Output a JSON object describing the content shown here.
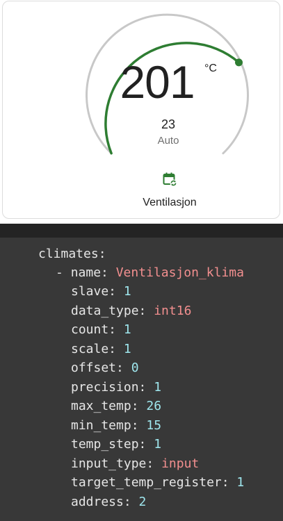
{
  "thermostat": {
    "current_temperature": "201",
    "unit": "°C",
    "target_temperature": "23",
    "hvac_mode": "Auto",
    "entity_name": "Ventilasjon",
    "icon": "calendar-sync-icon",
    "accent_color": "#2e7d32",
    "track_color": "#c8c8c8"
  },
  "config": {
    "root_key": "climates:",
    "dash": "-",
    "entries": [
      {
        "key": "name:",
        "value": "Ventilasjon_klima",
        "kind": "string"
      },
      {
        "key": "slave:",
        "value": "1",
        "kind": "number"
      },
      {
        "key": "data_type:",
        "value": "int16",
        "kind": "string"
      },
      {
        "key": "count:",
        "value": "1",
        "kind": "number"
      },
      {
        "key": "scale:",
        "value": "1",
        "kind": "number"
      },
      {
        "key": "offset:",
        "value": "0",
        "kind": "number"
      },
      {
        "key": "precision:",
        "value": "1",
        "kind": "number"
      },
      {
        "key": "max_temp:",
        "value": "26",
        "kind": "number"
      },
      {
        "key": "min_temp:",
        "value": "15",
        "kind": "number"
      },
      {
        "key": "temp_step:",
        "value": "1",
        "kind": "number"
      },
      {
        "key": "input_type:",
        "value": "input",
        "kind": "string"
      },
      {
        "key": "target_temp_register:",
        "value": "1",
        "kind": "number"
      },
      {
        "key": "address:",
        "value": "2",
        "kind": "number"
      }
    ]
  }
}
